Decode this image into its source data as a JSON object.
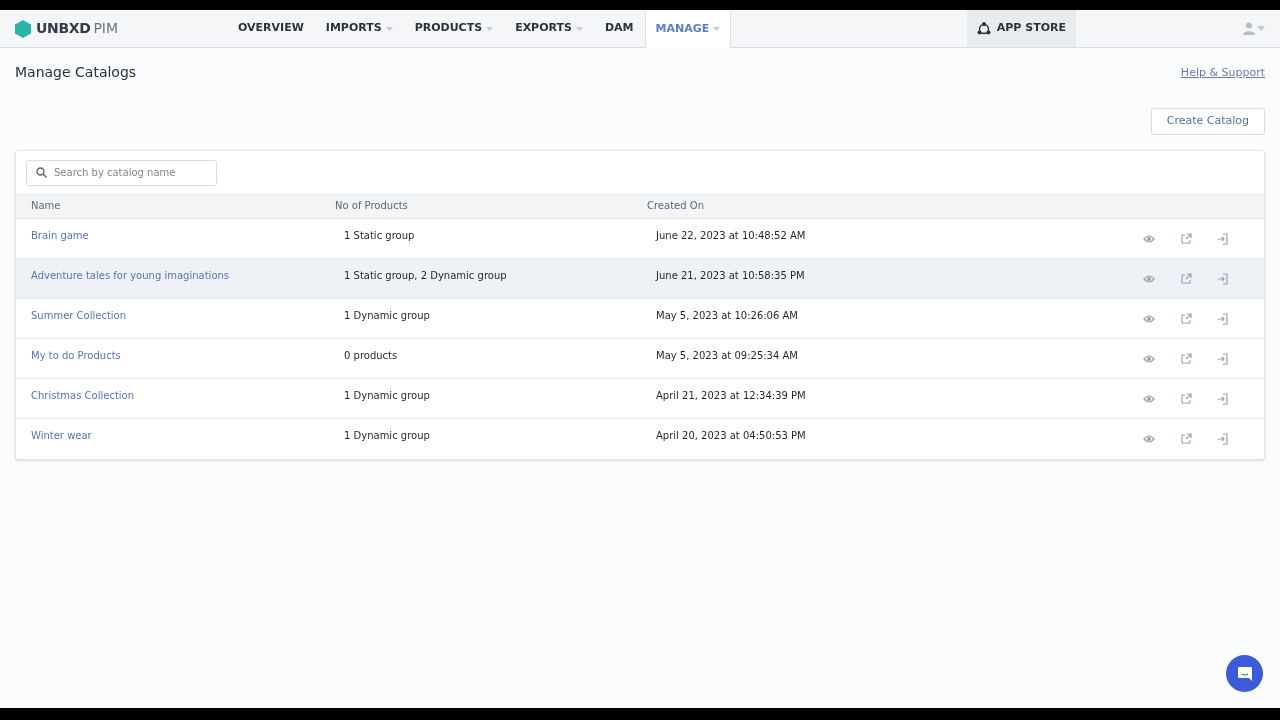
{
  "brand": {
    "name": "UNBXD",
    "product": "PIM"
  },
  "nav": [
    {
      "label": "OVERVIEW",
      "has_menu": false,
      "selected": false
    },
    {
      "label": "IMPORTS",
      "has_menu": true,
      "selected": false
    },
    {
      "label": "PRODUCTS",
      "has_menu": true,
      "selected": false
    },
    {
      "label": "EXPORTS",
      "has_menu": true,
      "selected": false
    },
    {
      "label": "DAM",
      "has_menu": false,
      "selected": false
    },
    {
      "label": "MANAGE",
      "has_menu": true,
      "selected": true
    }
  ],
  "app_store": {
    "label": "APP STORE"
  },
  "page": {
    "title": "Manage Catalogs",
    "help_link": "Help & Support",
    "create_button": "Create Catalog"
  },
  "search": {
    "placeholder": "Search by catalog name"
  },
  "table": {
    "columns": [
      "Name",
      "No of Products",
      "Created On"
    ],
    "rows": [
      {
        "name": "Brain game",
        "products": "1 Static group",
        "created": "June 22, 2023 at 10:48:52 AM",
        "hovered": false
      },
      {
        "name": "Adventure tales for young imaginations",
        "products": "1 Static group, 2 Dynamic group",
        "created": "June 21, 2023 at 10:58:35 PM",
        "hovered": true
      },
      {
        "name": "Summer Collection",
        "products": "1 Dynamic group",
        "created": "May 5, 2023 at 10:26:06 AM",
        "hovered": false
      },
      {
        "name": "My to do Products",
        "products": "0 products",
        "created": "May 5, 2023 at 09:25:34 AM",
        "hovered": false
      },
      {
        "name": "Christmas Collection",
        "products": "1 Dynamic group",
        "created": "April 21, 2023 at 12:34:39 PM",
        "hovered": false
      },
      {
        "name": "Winter wear",
        "products": "1 Dynamic group",
        "created": "April 20, 2023 at 04:50:53 PM",
        "hovered": false
      }
    ]
  }
}
